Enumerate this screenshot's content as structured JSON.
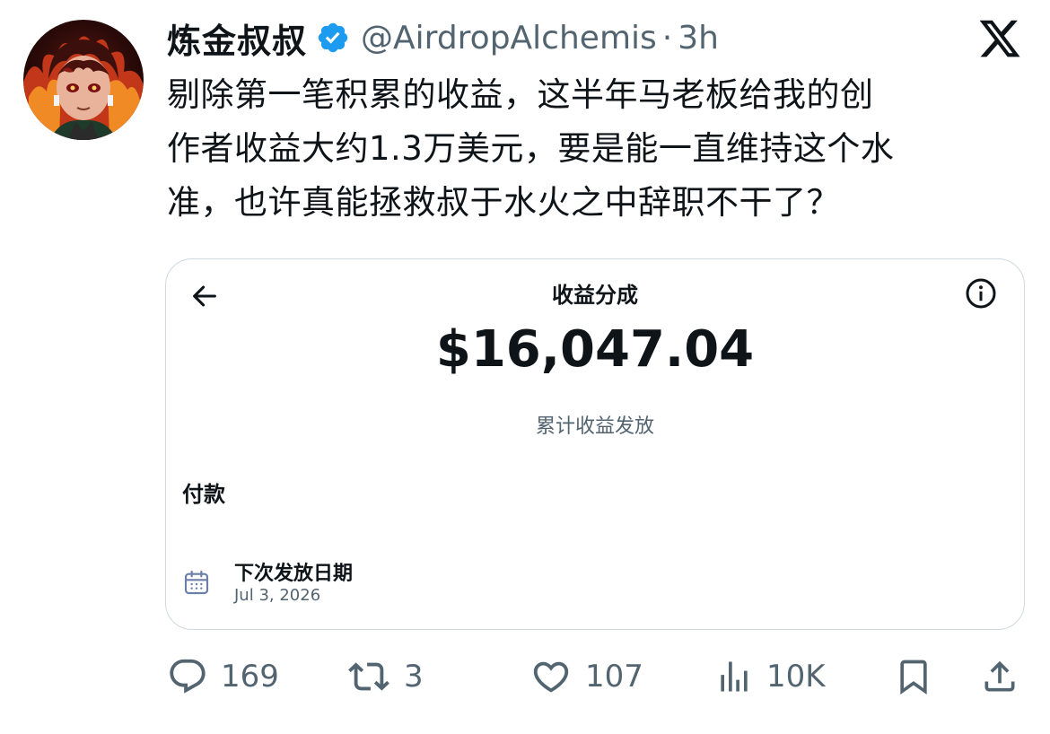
{
  "tweet": {
    "display_name": "炼金叔叔",
    "handle": "@AirdropAlchemis",
    "separator": "·",
    "time": "3h",
    "text": "剔除第一笔积累的收益，这半年马老板给我的创\n作者收益大约1.3万美元，要是能一直维持这个水\n准，也许真能拯救叔于水火之中辞职不干了？"
  },
  "card": {
    "title": "收益分成",
    "amount": "$16,047.04",
    "subtitle": "累计收益发放",
    "section_label": "付款",
    "next_payout_label": "下次发放日期",
    "next_payout_date": "Jul 3, 2026"
  },
  "actions": {
    "replies": "169",
    "reposts": "3",
    "likes": "107",
    "views": "10K"
  },
  "icons": {
    "verified": "verified-badge-icon",
    "platform": "x-logo-icon",
    "back": "arrow-left-icon",
    "info": "info-icon",
    "calendar": "calendar-icon",
    "reply": "reply-icon",
    "repost": "repost-icon",
    "like": "heart-icon",
    "views": "views-chart-icon",
    "bookmark": "bookmark-icon",
    "share": "share-icon"
  },
  "colors": {
    "text_primary": "#0f1419",
    "text_secondary": "#536471",
    "verified_blue": "#1d9bf0",
    "card_border": "#cfd9de"
  }
}
